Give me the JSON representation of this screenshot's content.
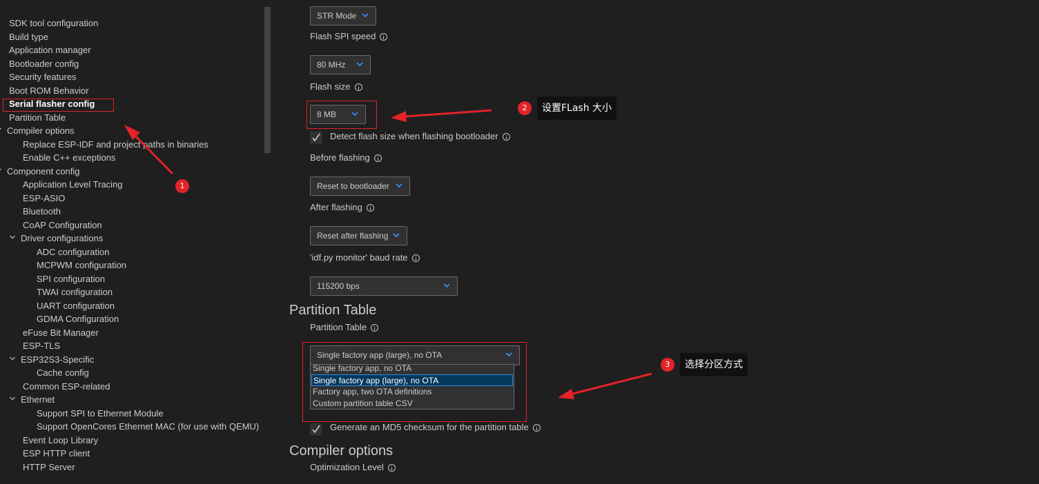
{
  "sidebar": {
    "items": [
      {
        "label": "SDK tool configuration",
        "expand": "none"
      },
      {
        "label": "Build type",
        "expand": "none"
      },
      {
        "label": "Application manager",
        "expand": "none"
      },
      {
        "label": "Bootloader config",
        "expand": "none"
      },
      {
        "label": "Security features",
        "expand": "none"
      },
      {
        "label": "Boot ROM Behavior",
        "expand": "none"
      },
      {
        "label": "Serial flasher config",
        "expand": "none",
        "active": true
      },
      {
        "label": "Partition Table",
        "expand": "none"
      },
      {
        "label": "Compiler options",
        "expand": "expanded"
      },
      {
        "label": "Replace ESP-IDF and project paths in binaries",
        "expand": "none"
      },
      {
        "label": "Enable C++ exceptions",
        "expand": "none"
      },
      {
        "label": "Component config",
        "expand": "expanded"
      },
      {
        "label": "Application Level Tracing",
        "expand": "none"
      },
      {
        "label": "ESP-ASIO",
        "expand": "none"
      },
      {
        "label": "Bluetooth",
        "expand": "none"
      },
      {
        "label": "CoAP Configuration",
        "expand": "none"
      },
      {
        "label": "Driver configurations",
        "expand": "expanded"
      },
      {
        "label": "ADC configuration",
        "expand": "none"
      },
      {
        "label": "MCPWM configuration",
        "expand": "none"
      },
      {
        "label": "SPI configuration",
        "expand": "none"
      },
      {
        "label": "TWAI configuration",
        "expand": "none"
      },
      {
        "label": "UART configuration",
        "expand": "none"
      },
      {
        "label": "GDMA Configuration",
        "expand": "none"
      },
      {
        "label": "eFuse Bit Manager",
        "expand": "none"
      },
      {
        "label": "ESP-TLS",
        "expand": "none"
      },
      {
        "label": "ESP32S3-Specific",
        "expand": "expanded"
      },
      {
        "label": "Cache config",
        "expand": "none"
      },
      {
        "label": "Common ESP-related",
        "expand": "none"
      },
      {
        "label": "Ethernet",
        "expand": "expanded"
      },
      {
        "label": "Support SPI to Ethernet Module",
        "expand": "none"
      },
      {
        "label": "Support OpenCores Ethernet MAC (for use with QEMU)",
        "expand": "none"
      },
      {
        "label": "Event Loop Library",
        "expand": "none"
      },
      {
        "label": "ESP HTTP client",
        "expand": "none"
      },
      {
        "label": "HTTP Server",
        "expand": "none"
      }
    ]
  },
  "settings": {
    "flash_mode_value": "STR Mode",
    "flash_spi_speed_label": "Flash SPI speed",
    "flash_spi_speed_value": "80 MHz",
    "flash_size_label": "Flash size",
    "flash_size_value": "8 MB",
    "detect_flash_label": "Detect flash size when flashing bootloader",
    "detect_flash_checked": true,
    "before_flashing_label": "Before flashing",
    "before_flashing_value": "Reset to bootloader",
    "after_flashing_label": "After flashing",
    "after_flashing_value": "Reset after flashing",
    "monitor_baud_label": "'idf.py monitor' baud rate",
    "monitor_baud_value": "115200 bps"
  },
  "partition_section": {
    "title": "Partition Table",
    "partition_table_label": "Partition Table",
    "partition_table_value": "Single factory app (large), no OTA",
    "options": [
      "Single factory app, no OTA",
      "Single factory app (large), no OTA",
      "Factory app, two OTA definitions",
      "Custom partition table CSV"
    ],
    "selected_option_index": 1,
    "md5_label": "Generate an MD5 checksum for the partition table",
    "md5_checked": true
  },
  "compiler_section": {
    "title": "Compiler options",
    "optimization_label": "Optimization Level"
  },
  "annotations": {
    "badge1": "1",
    "badge2": "2",
    "badge3": "3",
    "callout2": "设置FLash 大小",
    "callout3": "选择分区方式",
    "annotation_color": "#e3232a"
  },
  "colors": {
    "background": "#1f1f1f",
    "dropdown_selected": "#04395e",
    "chevron": "#3794ff"
  }
}
